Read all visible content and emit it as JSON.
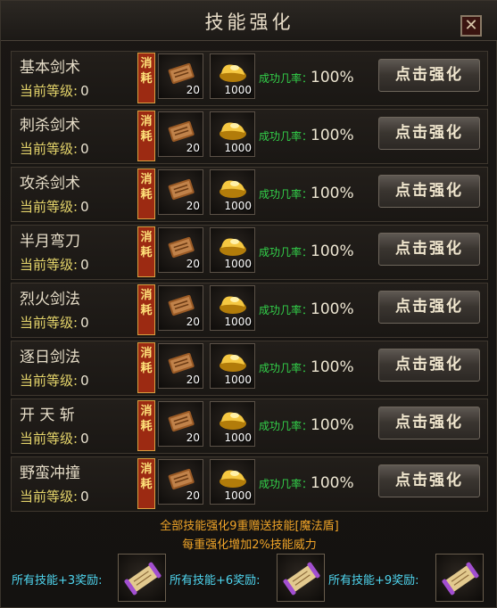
{
  "window": {
    "title": "技能强化",
    "close_icon": "close-icon"
  },
  "cost_banner": [
    "消",
    "耗"
  ],
  "rate_label": "成功几率：",
  "button_label": "点击强化",
  "level_label": "当前等级:",
  "skills": [
    {
      "name": "基本剑术",
      "level": "0",
      "book_count": "20",
      "gold_count": "1000",
      "rate": "100%"
    },
    {
      "name": "刺杀剑术",
      "level": "0",
      "book_count": "20",
      "gold_count": "1000",
      "rate": "100%"
    },
    {
      "name": "攻杀剑术",
      "level": "0",
      "book_count": "20",
      "gold_count": "1000",
      "rate": "100%"
    },
    {
      "name": "半月弯刀",
      "level": "0",
      "book_count": "20",
      "gold_count": "1000",
      "rate": "100%"
    },
    {
      "name": "烈火剑法",
      "level": "0",
      "book_count": "20",
      "gold_count": "1000",
      "rate": "100%"
    },
    {
      "name": "逐日剑法",
      "level": "0",
      "book_count": "20",
      "gold_count": "1000",
      "rate": "100%"
    },
    {
      "name": "开 天 斩",
      "level": "0",
      "book_count": "20",
      "gold_count": "1000",
      "rate": "100%"
    },
    {
      "name": "野蛮冲撞",
      "level": "0",
      "book_count": "20",
      "gold_count": "1000",
      "rate": "100%"
    }
  ],
  "bonus": {
    "line1": "全部技能强化9重赠送技能[魔法盾]",
    "line2": "每重强化增加2%技能威力"
  },
  "rewards": [
    {
      "label": "所有技能+3奖励:",
      "icon": "scroll-icon"
    },
    {
      "label": "所有技能+6奖励:",
      "icon": "scroll-icon"
    },
    {
      "label": "所有技能+9奖励:",
      "icon": "scroll-icon"
    }
  ],
  "colors": {
    "level_label": "#e3d36a",
    "rate_label": "#33d24a",
    "bonus_text": "#f0a428",
    "reward_label": "#4fd6f0",
    "cost_banner": "#9c2a12"
  }
}
